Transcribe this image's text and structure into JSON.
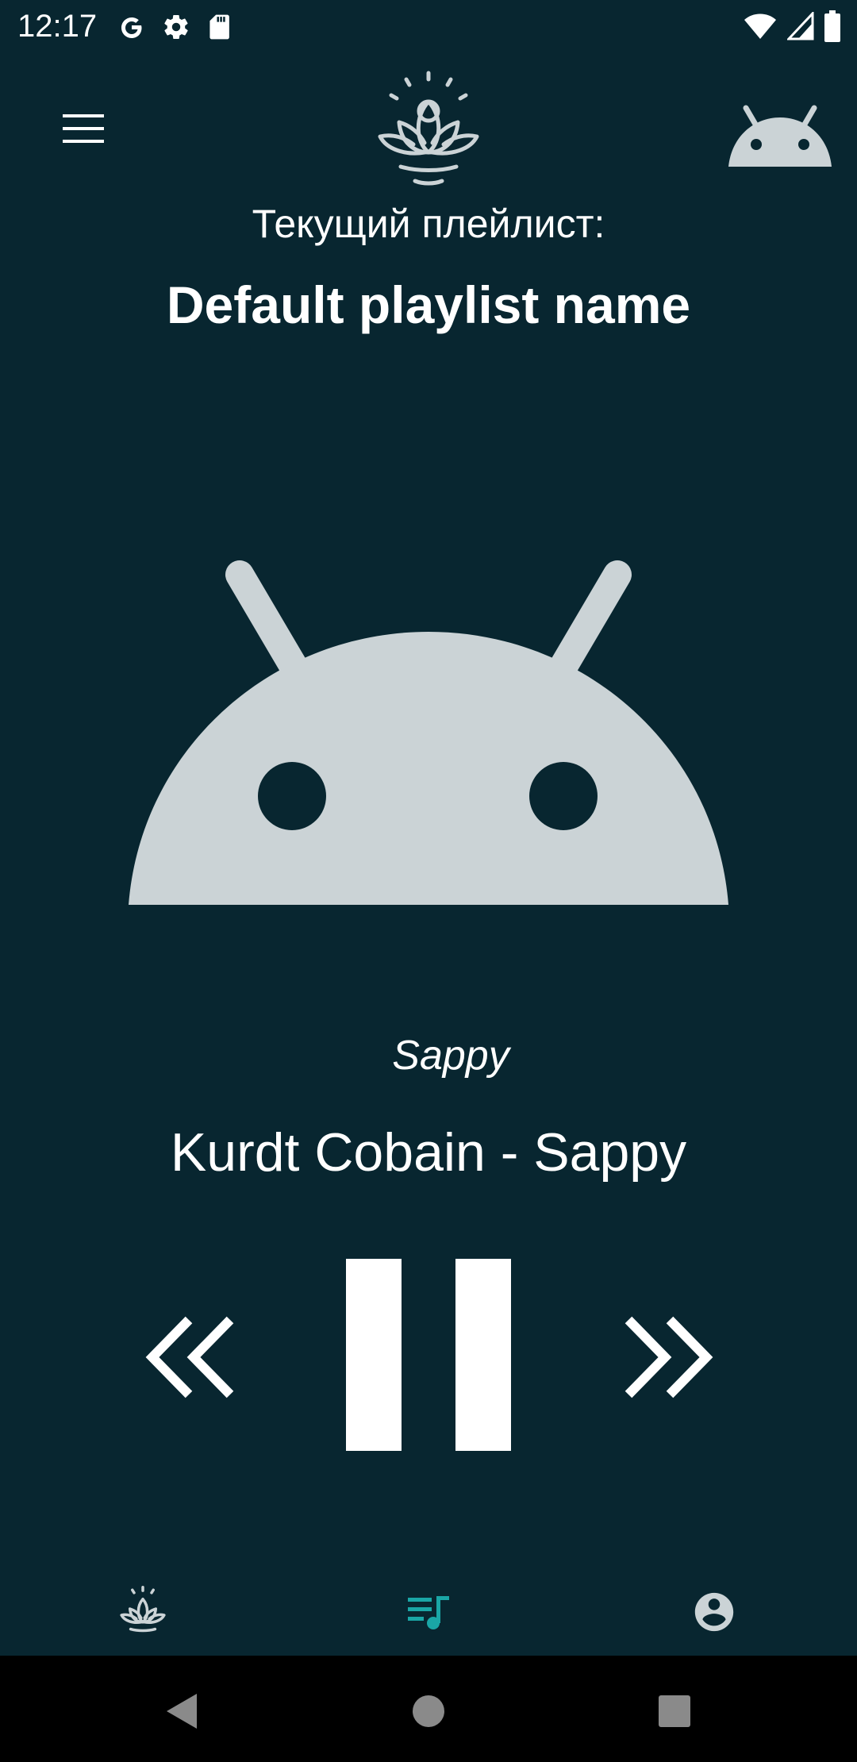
{
  "status_bar": {
    "time": "12:17",
    "icons_left": [
      "google-icon",
      "settings-gear-icon",
      "sd-card-icon"
    ],
    "icons_right": [
      "wifi-icon",
      "cell-signal-icon",
      "battery-icon"
    ]
  },
  "toolbar": {
    "menu_icon": "hamburger-menu-icon",
    "logo_icon": "lotus-logo-icon",
    "avatar_icon": "android-avatar-icon"
  },
  "playlist": {
    "caption": "Текущий плейлист:",
    "name": "Default playlist name"
  },
  "player": {
    "cover_icon": "android-cover-icon",
    "track_title": "Sappy",
    "artist": "Kurdt Cobain",
    "separator": " - ",
    "song": "Sappy",
    "state": "playing"
  },
  "controls": {
    "prev_icon": "double-chevron-left-icon",
    "pause_icon": "pause-icon",
    "next_icon": "double-chevron-right-icon"
  },
  "bottom_nav": {
    "items": [
      {
        "icon": "lotus-icon",
        "active": false
      },
      {
        "icon": "playlist-music-icon",
        "active": true
      },
      {
        "icon": "account-circle-icon",
        "active": false
      }
    ]
  },
  "system_nav": {
    "buttons": [
      "back-triangle-icon",
      "home-circle-icon",
      "recents-square-icon"
    ]
  },
  "colors": {
    "background": "#082630",
    "foreground": "#ffffff",
    "icon_gray": "#cbd3d6",
    "active_accent": "#1aa6a6",
    "system_nav": "#000000"
  }
}
